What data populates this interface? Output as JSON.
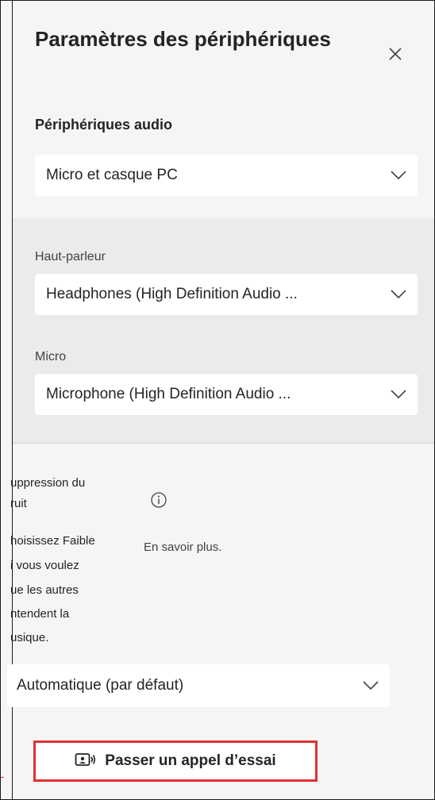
{
  "panel": {
    "title": "Paramètres des périphériques",
    "close_icon": "close-icon"
  },
  "audio": {
    "heading": "Périphériques audio",
    "device": "Micro et casque PC"
  },
  "speaker": {
    "label": "Haut-parleur",
    "value": "Headphones (High Definition Audio ..."
  },
  "micro": {
    "label": "Micro",
    "value": "Microphone (High Definition Audio ..."
  },
  "noise": {
    "label_line1": "uppression du",
    "label_line2": "ruit",
    "info_icon": "info-icon",
    "description": [
      "hoisissez Faible",
      "i vous voulez",
      "ue les autres",
      "ntendent la",
      "usique."
    ],
    "learn_more": "En savoir plus.",
    "value": "Automatique (par défaut)"
  },
  "test_call": {
    "label": "Passer un appel d’essai",
    "icon": "test-call-icon",
    "highlight_color": "#e03131"
  }
}
